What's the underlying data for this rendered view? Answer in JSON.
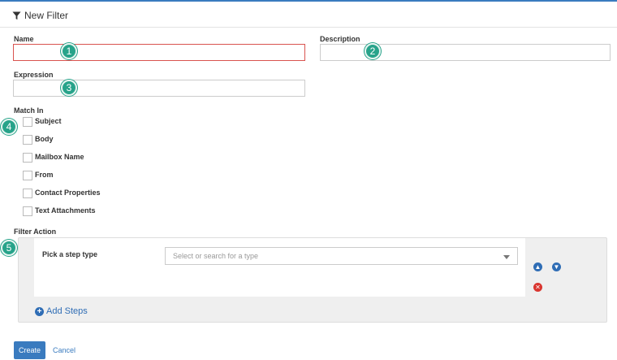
{
  "header": {
    "title": "New Filter",
    "icon": "filter-icon"
  },
  "form": {
    "name_label": "Name",
    "name_value": "",
    "description_label": "Description",
    "description_value": "",
    "expression_label": "Expression",
    "expression_value": "",
    "match_in_label": "Match In",
    "match_in_options": [
      {
        "label": "Subject",
        "checked": false
      },
      {
        "label": "Body",
        "checked": false
      },
      {
        "label": "Mailbox Name",
        "checked": false
      },
      {
        "label": "From",
        "checked": false
      },
      {
        "label": "Contact Properties",
        "checked": false
      },
      {
        "label": "Text Attachments",
        "checked": false
      }
    ],
    "filter_action_label": "Filter Action"
  },
  "step": {
    "label": "Pick a step type",
    "select_placeholder": "Select or search for a type"
  },
  "add_steps_label": "Add Steps",
  "actions": {
    "create_label": "Create",
    "cancel_label": "Cancel"
  },
  "badges": [
    "1",
    "2",
    "3",
    "4",
    "5"
  ],
  "colors": {
    "accent": "#3a7bbf",
    "badge": "#27a38a",
    "error_border": "#d9534f",
    "remove": "#d9352f"
  }
}
